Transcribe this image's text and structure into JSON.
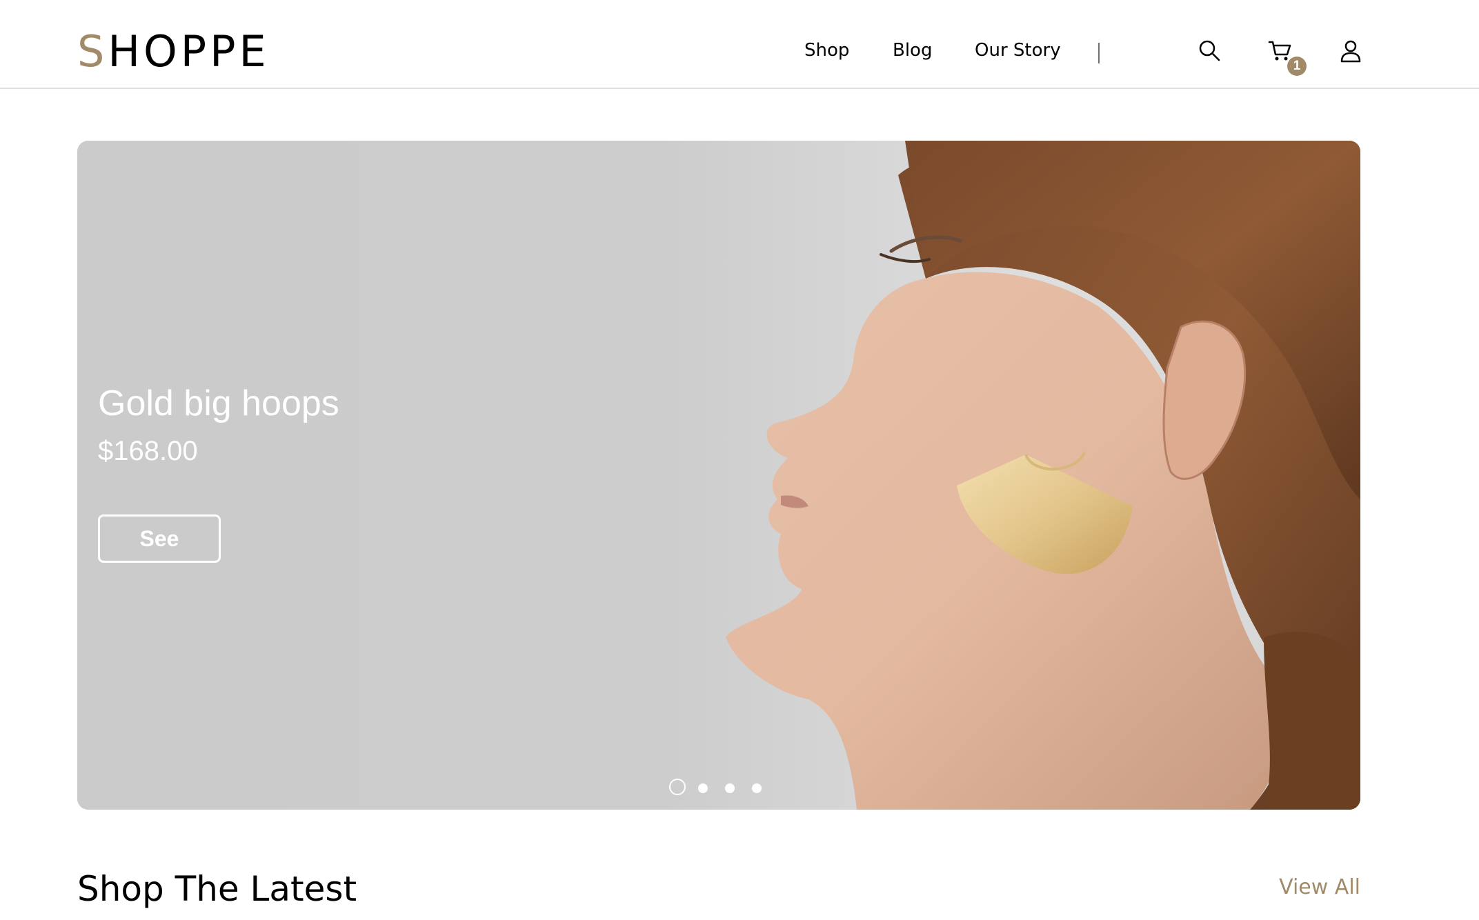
{
  "brand": {
    "logo_first_letter": "S",
    "logo_rest": "HOPPE",
    "accent_color": "#a18a68"
  },
  "nav": {
    "items": [
      {
        "label": "Shop"
      },
      {
        "label": "Blog"
      },
      {
        "label": "Our Story"
      }
    ],
    "icons": [
      "search-icon",
      "cart-icon",
      "user-icon"
    ],
    "cart_count": "1"
  },
  "hero": {
    "title": "Gold big hoops",
    "price": "$168.00",
    "button_label": "See",
    "slide_count": 4,
    "active_slide": 1
  },
  "latest": {
    "title": "Shop The Latest",
    "view_all_label": "View All"
  }
}
